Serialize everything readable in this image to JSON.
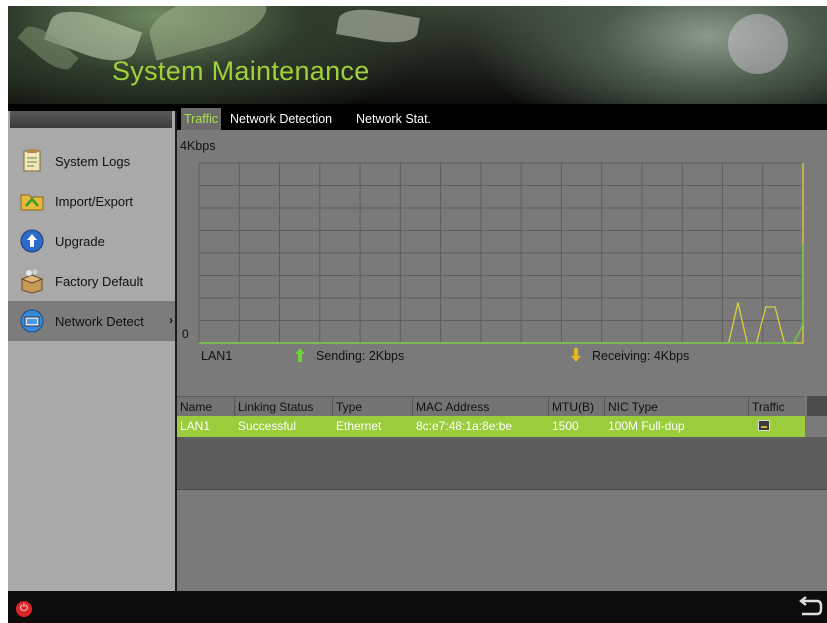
{
  "header": {
    "title": "System Maintenance"
  },
  "sidebar": {
    "items": [
      {
        "label": "System Logs",
        "icon": "document-icon"
      },
      {
        "label": "Import/Export",
        "icon": "folder-icon"
      },
      {
        "label": "Upgrade",
        "icon": "upload-icon"
      },
      {
        "label": "Factory Default",
        "icon": "box-icon"
      },
      {
        "label": "Network Detect",
        "icon": "network-icon",
        "arrow": "›",
        "active": true
      }
    ]
  },
  "tabs": [
    {
      "label": "Traffic",
      "active": true
    },
    {
      "label": "Network Detection"
    },
    {
      "label": "Network Stat."
    }
  ],
  "chart_data": {
    "type": "line",
    "y_max_label": "4Kbps",
    "y_min_label": "0",
    "ylim": [
      0,
      4
    ],
    "grid": true,
    "x": [
      0,
      1,
      2,
      3,
      4,
      5,
      6,
      7,
      8,
      9,
      10,
      11,
      12,
      13,
      14,
      15,
      16,
      17,
      18,
      19,
      20,
      21,
      22,
      23,
      24,
      25,
      26,
      27,
      28,
      29,
      30,
      31,
      32,
      33,
      34,
      35,
      36,
      37,
      38,
      39,
      40,
      41,
      42,
      43,
      44,
      45,
      46,
      47,
      48,
      49,
      50,
      51,
      52,
      53,
      54,
      55,
      56,
      57,
      58,
      59,
      60,
      61,
      62,
      63,
      64,
      65
    ],
    "series": [
      {
        "color": "#d6d23a",
        "values": [
          0,
          0,
          0,
          0,
          0,
          0,
          0,
          0,
          0,
          0,
          0,
          0,
          0,
          0,
          0,
          0,
          0,
          0,
          0,
          0,
          0,
          0,
          0,
          0,
          0,
          0,
          0,
          0,
          0,
          0,
          0,
          0,
          0,
          0,
          0,
          0,
          0,
          0,
          0,
          0,
          0,
          0,
          0,
          0,
          0,
          0,
          0,
          0,
          0,
          0,
          0,
          0,
          0,
          0,
          0,
          0,
          0,
          0,
          0.9,
          0,
          0,
          0.8,
          0.8,
          0,
          0,
          0,
          2.7,
          4
        ]
      },
      {
        "color": "#6fd23a",
        "values": [
          0,
          0,
          0,
          0,
          0,
          0,
          0,
          0,
          0,
          0,
          0,
          0,
          0,
          0,
          0,
          0,
          0,
          0,
          0,
          0,
          0,
          0,
          0,
          0,
          0,
          0,
          0,
          0,
          0,
          0,
          0,
          0,
          0,
          0,
          0,
          0,
          0,
          0,
          0,
          0,
          0,
          0,
          0,
          0,
          0,
          0,
          0,
          0,
          0,
          0,
          0,
          0,
          0,
          0,
          0,
          0,
          0,
          0,
          0,
          0,
          0,
          0,
          0,
          0,
          0,
          0.4,
          2.2,
          1.8
        ]
      }
    ],
    "interface": "LAN1",
    "sending_label": "Sending: 2Kbps",
    "receiving_label": "Receiving: 4Kbps",
    "sending_color": "#6fd23a",
    "receiving_color": "#e6b820"
  },
  "table": {
    "headers": [
      "Name",
      "Linking Status",
      "Type",
      "MAC Address",
      "MTU(B)",
      "NIC Type",
      "Traffic"
    ],
    "rows": [
      [
        "LAN1",
        "Successful",
        "Ethernet",
        "8c:e7:48:1a:8e:be",
        "1500",
        "100M Full-dup"
      ]
    ]
  },
  "footer": {
    "power_icon": "power-icon",
    "back_icon": "back-icon"
  }
}
